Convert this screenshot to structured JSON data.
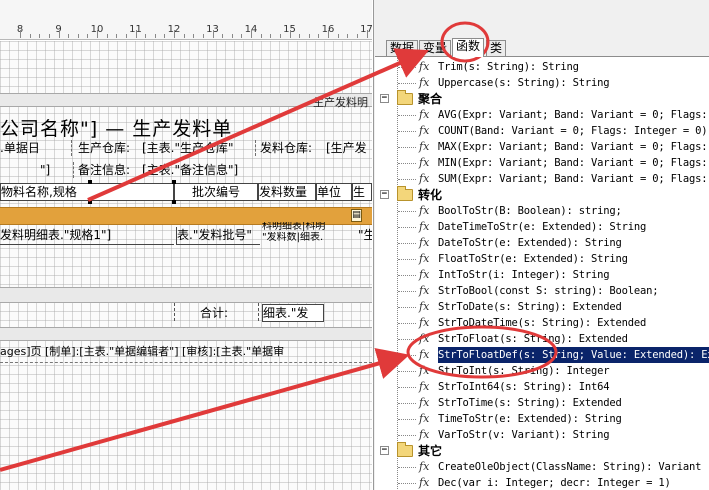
{
  "ruler": {
    "numbers": [
      "8",
      "9",
      "10",
      "11",
      "12",
      "13",
      "14",
      "15",
      "16",
      "17"
    ]
  },
  "report": {
    "top_band_label": "生产发料明",
    "title": "公司名称\"] — 生产发料单",
    "header_row1": {
      "date": ".单据日",
      "warehouse_label": "生产仓库:",
      "warehouse_value": "[主表.\"生产仓库\"",
      "issue_label": "发料仓库:",
      "issue_value": "[生产发"
    },
    "header_row2": {
      "bracket": "\"]",
      "remark_label": "备注信息:",
      "remark_value": "[主表.\"备注信息\"]"
    },
    "columns": [
      "物料名称,规格",
      "批次编号",
      "发料数量",
      "单位",
      "生"
    ],
    "detail_row": {
      "spec": "发料明细表.\"规格1\"]",
      "batch": "表.\"发料批号\"",
      "qty_top": "科明细表|科明",
      "qty_bottom": "\"发料数|细表.",
      "last": "\"生"
    },
    "total_label": "合计:",
    "total_value": "细表.\"发",
    "footer": "ages]页  [制单]:[主表.\"单据编辑者\"]  [审核]:[主表.\"单据审"
  },
  "panel": {
    "tabs": [
      "数据",
      "变量",
      "函数",
      "类"
    ],
    "active_tab": "函数",
    "tree": [
      {
        "kind": "fn",
        "sig": "Trim(s: String): String"
      },
      {
        "kind": "fn",
        "sig": "Uppercase(s: String): String"
      },
      {
        "kind": "cat",
        "label": "聚合"
      },
      {
        "kind": "fn",
        "sig": "AVG(Expr: Variant; Band: Variant = 0; Flags: I"
      },
      {
        "kind": "fn",
        "sig": "COUNT(Band: Variant = 0; Flags: Integer = 0):"
      },
      {
        "kind": "fn",
        "sig": "MAX(Expr: Variant; Band: Variant = 0; Flags: I"
      },
      {
        "kind": "fn",
        "sig": "MIN(Expr: Variant; Band: Variant = 0; Flags: I"
      },
      {
        "kind": "fn",
        "sig": "SUM(Expr: Variant; Band: Variant = 0; Flags: I"
      },
      {
        "kind": "cat",
        "label": "转化"
      },
      {
        "kind": "fn",
        "sig": "BoolToStr(B: Boolean): string;"
      },
      {
        "kind": "fn",
        "sig": "DateTimeToStr(e: Extended): String"
      },
      {
        "kind": "fn",
        "sig": "DateToStr(e: Extended): String"
      },
      {
        "kind": "fn",
        "sig": "FloatToStr(e: Extended): String"
      },
      {
        "kind": "fn",
        "sig": "IntToStr(i: Integer): String"
      },
      {
        "kind": "fn",
        "sig": "StrToBool(const S: string): Boolean;"
      },
      {
        "kind": "fn",
        "sig": "StrToDate(s: String): Extended"
      },
      {
        "kind": "fn",
        "sig": "StrToDateTime(s: String): Extended"
      },
      {
        "kind": "fn",
        "sig": "StrToFloat(s: String): Extended"
      },
      {
        "kind": "fn",
        "sig": "StrToFloatDef(s: String; Value: Extended): Ext",
        "selected": true
      },
      {
        "kind": "fn",
        "sig": "StrToInt(s: String): Integer"
      },
      {
        "kind": "fn",
        "sig": "StrToInt64(s: String): Int64"
      },
      {
        "kind": "fn",
        "sig": "StrToTime(s: String): Extended"
      },
      {
        "kind": "fn",
        "sig": "TimeToStr(e: Extended): String"
      },
      {
        "kind": "fn",
        "sig": "VarToStr(v: Variant): String"
      },
      {
        "kind": "cat",
        "label": "其它"
      },
      {
        "kind": "fn",
        "sig": "CreateOleObject(ClassName: String): Variant"
      },
      {
        "kind": "fn",
        "sig": "Dec(var i: Integer; decr: Integer = 1)"
      }
    ],
    "fx_symbol": "fx",
    "collapse_symbol": "−"
  },
  "colors": {
    "accent_red": "#e03a3a",
    "selection": "#0a246a",
    "detail_band": "#e2a13c"
  }
}
